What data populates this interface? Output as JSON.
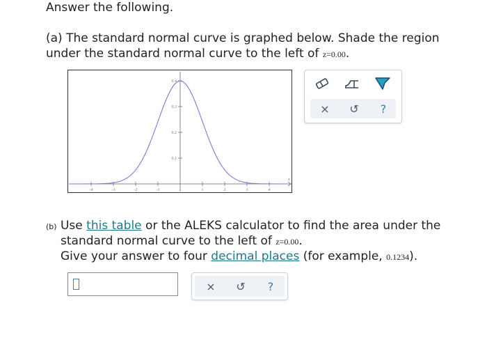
{
  "header": {
    "title": "Answer the following."
  },
  "part_a": {
    "line1": "(a) The standard normal curve is graphed below. Shade the region",
    "line2_prefix": "under the standard normal curve to the left of",
    "z_value": "z=0.00",
    "line2_suffix": "."
  },
  "graph": {
    "y_ticks": [
      "0.4",
      "0.3",
      "0.2",
      "0.1"
    ],
    "x_ticks": [
      "-4",
      "-3",
      "-2",
      "-1",
      "1",
      "2",
      "3",
      "4"
    ],
    "x_axis_label": "z"
  },
  "graph_tools": {
    "tools": [
      "eraser-icon",
      "left-region-icon",
      "flag-icon"
    ],
    "actions": [
      "clear",
      "undo",
      "help"
    ],
    "clear_label": "×",
    "undo_label": "↺",
    "help_label": "?"
  },
  "part_b": {
    "label": "(b)",
    "line1_use": "Use",
    "table_link": "this table",
    "line1_rest": "or the ALEKS calculator to find the area under the",
    "line2_prefix": "standard normal curve to the left of",
    "z_value": "z=0.00",
    "line2_suffix": ".",
    "line3_prefix": "Give your answer to four",
    "decimal_link": "decimal places",
    "line3_mid": "(for example,",
    "example_value": "0.1234",
    "line3_suffix": ")."
  },
  "answer": {
    "value": ""
  },
  "answer_tools": {
    "clear_label": "×",
    "undo_label": "↺",
    "help_label": "?"
  }
}
